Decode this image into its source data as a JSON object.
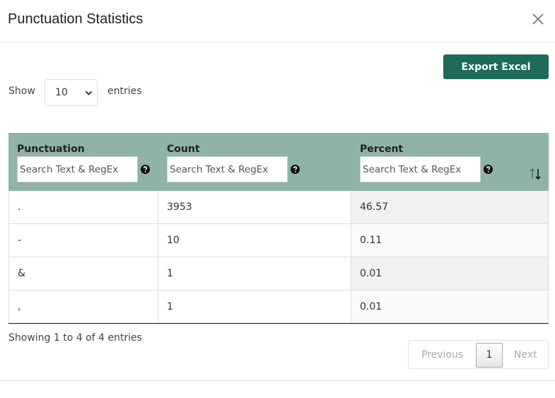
{
  "modal": {
    "title": "Punctuation Statistics"
  },
  "toolbar": {
    "export_label": "Export Excel"
  },
  "length": {
    "show_label": "Show",
    "selected": "10",
    "entries_label": "entries"
  },
  "table": {
    "columns": [
      {
        "label": "Punctuation",
        "placeholder": "Search Text & RegEx"
      },
      {
        "label": "Count",
        "placeholder": "Search Text & RegEx"
      },
      {
        "label": "Percent",
        "placeholder": "Search Text & RegEx"
      }
    ],
    "rows": [
      {
        "punctuation": ".",
        "count": "3953",
        "percent": "46.57"
      },
      {
        "punctuation": "-",
        "count": "10",
        "percent": "0.11"
      },
      {
        "punctuation": "&",
        "count": "1",
        "percent": "0.01"
      },
      {
        "punctuation": ",",
        "count": "1",
        "percent": "0.01"
      }
    ]
  },
  "info": "Showing 1 to 4 of 4 entries",
  "pagination": {
    "previous": "Previous",
    "current": "1",
    "next": "Next"
  },
  "icons": {
    "close": "close-icon",
    "help": "question-circle-icon",
    "sort": "sort-icon",
    "select_chevron": "chevron-down-icon"
  },
  "colors": {
    "accent": "#1e6a5b",
    "header_bg": "#8fb3a7"
  }
}
